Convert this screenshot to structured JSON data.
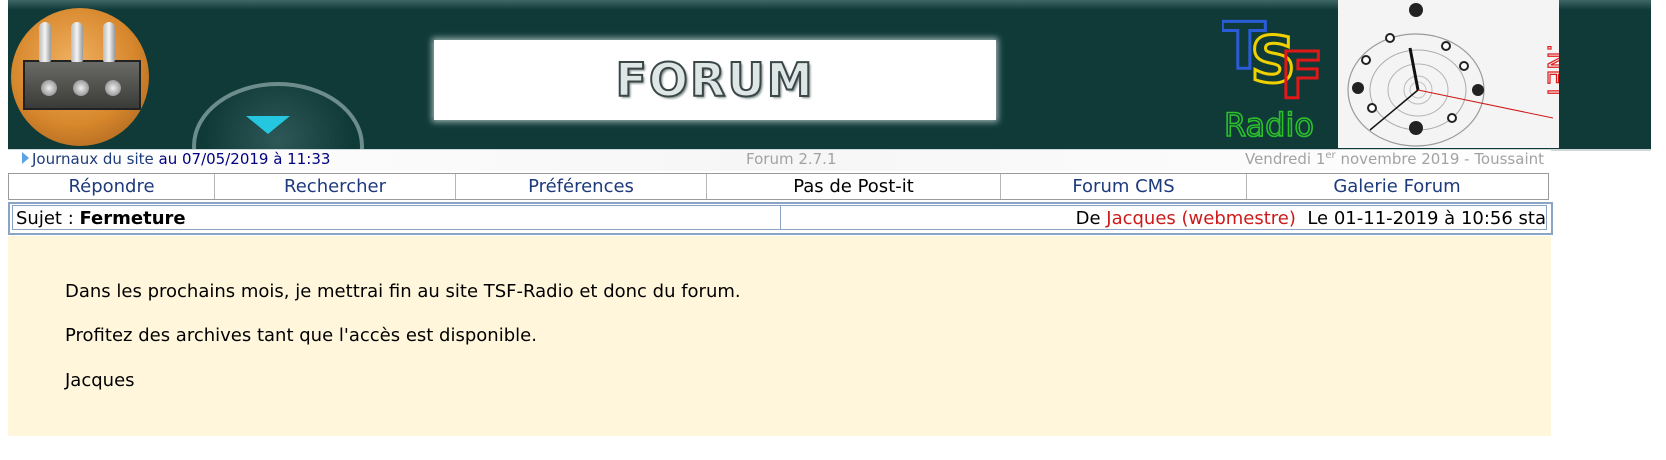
{
  "header": {
    "banner_title": "FORUM",
    "tsf_logo_letters": "TSF",
    "tsf_logo_word": "Radio",
    "net_label": ".NET",
    "colors": {
      "header_bg": "#0f3a38",
      "accent_cyan": "#25c6e0",
      "tsf_blue": "#2a5cd8",
      "tsf_yellow": "#f1d000",
      "tsf_red": "#e01818",
      "radio_green": "#2bbf2b"
    }
  },
  "info_bar": {
    "journal_link": "Journaux du site",
    "journal_date": " au 07/05/2019 à 11:33",
    "version": "Forum 2.7.1",
    "date_before": "Vendredi 1",
    "date_sup": "er",
    "date_after": " novembre 2019 - Toussaint"
  },
  "nav": {
    "reply": "Répondre",
    "search": "Rechercher",
    "preferences": "Préférences",
    "postit": "Pas de Post-it",
    "forum_cms": "Forum CMS",
    "gallery": "Galerie Forum"
  },
  "topic": {
    "subject_label": "Sujet : ",
    "subject_title": "Fermeture",
    "author_prefix": "De ",
    "author_name": "Jacques (webmestre)",
    "posted": "  Le 01-11-2019 à 10:56 sta"
  },
  "message": {
    "line1": "Dans les prochains mois, je mettrai fin au site TSF-Radio et donc du forum.",
    "line2": "Profitez des archives tant que l'accès est disponible.",
    "signature": "Jacques"
  }
}
